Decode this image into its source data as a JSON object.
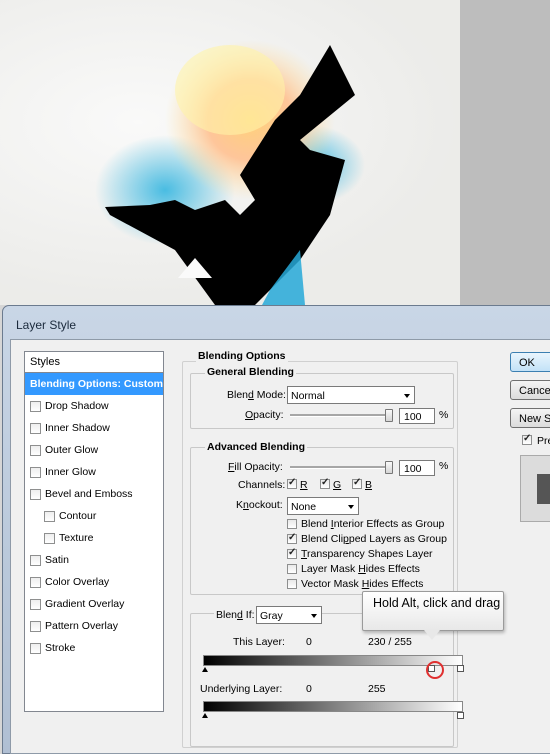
{
  "dialog": {
    "title": "Layer Style"
  },
  "styles_panel": {
    "header": "Styles",
    "items": [
      {
        "label": "Blending Options: Custom",
        "selected": true
      },
      {
        "label": "Drop Shadow"
      },
      {
        "label": "Inner Shadow"
      },
      {
        "label": "Outer Glow"
      },
      {
        "label": "Inner Glow"
      },
      {
        "label": "Bevel and Emboss"
      },
      {
        "label": "Contour",
        "sub": true
      },
      {
        "label": "Texture",
        "sub": true
      },
      {
        "label": "Satin"
      },
      {
        "label": "Color Overlay"
      },
      {
        "label": "Gradient Overlay"
      },
      {
        "label": "Pattern Overlay"
      },
      {
        "label": "Stroke"
      }
    ]
  },
  "blending_options": {
    "title": "Blending Options",
    "general": {
      "title": "General Blending",
      "blend_mode_label_pre": "Blen",
      "blend_mode_label_ul": "d",
      "blend_mode_label_post": " Mode:",
      "blend_mode_value": "Normal",
      "opacity_label_pre": "",
      "opacity_label_ul": "O",
      "opacity_label_post": "pacity:",
      "opacity_value": "100",
      "opacity_unit": "%"
    },
    "advanced": {
      "title": "Advanced Blending",
      "fill_label_ul": "F",
      "fill_label_post": "ill Opacity:",
      "fill_value": "100",
      "fill_unit": "%",
      "channels_label": "Channels:",
      "channel_r": "R",
      "channel_g": "G",
      "channel_b": "B",
      "knockout_label_pre": "K",
      "knockout_label_ul": "n",
      "knockout_label_post": "ockout:",
      "knockout_value": "None",
      "options": [
        {
          "pre": "Blend ",
          "ul": "I",
          "post": "nterior Effects as Group",
          "checked": false
        },
        {
          "pre": "Blend Cli",
          "ul": "p",
          "post": "ped Layers as Group",
          "checked": true
        },
        {
          "pre": "",
          "ul": "T",
          "post": "ransparency Shapes Layer",
          "checked": true
        },
        {
          "pre": "Layer Mask ",
          "ul": "H",
          "post": "ides Effects",
          "checked": false
        },
        {
          "pre": "Vector Mask ",
          "ul": "H",
          "post": "ides Effects",
          "checked": false
        }
      ]
    },
    "blend_if": {
      "label_pre": "Blen",
      "label_ul": "d",
      "label_post": " If:",
      "value": "Gray",
      "this_layer_label": "This Layer:",
      "this_layer_min": "0",
      "this_layer_max": "230 / 255",
      "underlying_label": "Underlying Layer:",
      "underlying_min": "0",
      "underlying_max": "255"
    }
  },
  "buttons": {
    "ok": "OK",
    "cancel": "Cancel",
    "new_style": "New Style...",
    "preview": "Preview"
  },
  "annotation": {
    "tooltip": "Hold Alt, click and drag"
  }
}
